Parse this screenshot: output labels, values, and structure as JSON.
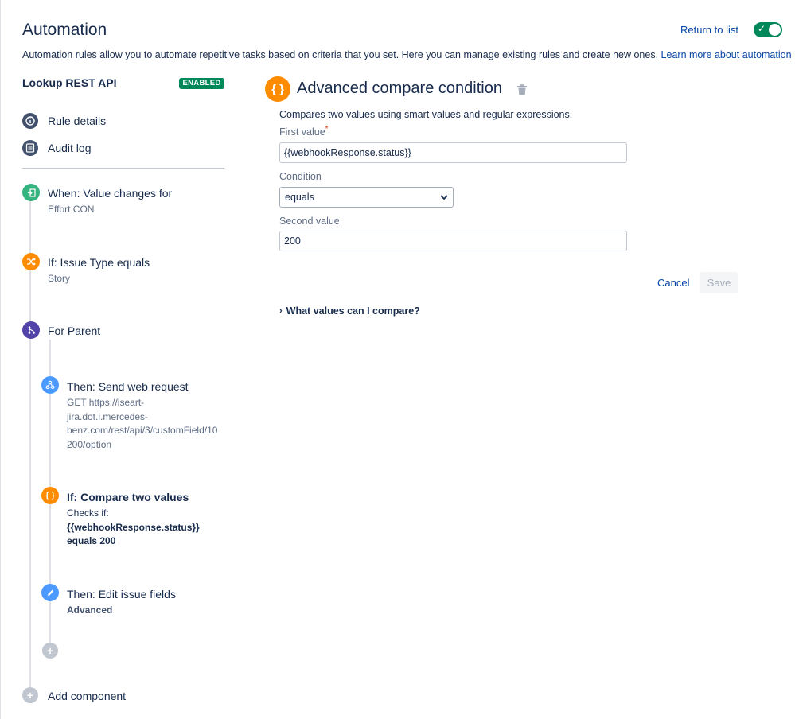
{
  "header": {
    "title": "Automation",
    "return_link": "Return to list",
    "toggle_state": "on",
    "description": "Automation rules allow you to automate repetitive tasks based on criteria that you set. Here you can manage existing rules and create new ones.",
    "learn_more": "Learn more about automation"
  },
  "sidebar": {
    "rule_name": "Lookup REST API",
    "status_badge": "ENABLED",
    "nav": [
      {
        "label": "Rule details",
        "icon": "info-icon"
      },
      {
        "label": "Audit log",
        "icon": "list-icon"
      }
    ],
    "steps": [
      {
        "title": "When: Value changes for",
        "sub": "Effort CON",
        "icon": "trigger-icon"
      },
      {
        "title": "If: Issue Type equals",
        "sub": "Story",
        "icon": "shuffle-icon"
      },
      {
        "title": "For Parent",
        "sub": "",
        "icon": "branch-icon"
      },
      {
        "title": "Then: Send web request",
        "sub_lines": [
          "GET https://iseart-",
          "jira.dot.i.mercedes-",
          "benz.com/rest/api/3/customField/10",
          "200/option"
        ],
        "icon": "webhook-icon"
      },
      {
        "title": "If: Compare two values",
        "sub_lines": [
          "Checks if:",
          "{{webhookResponse.status}}",
          "equals 200"
        ],
        "icon": "braces-icon"
      },
      {
        "title": "Then: Edit issue fields",
        "sub": "Advanced",
        "icon": "pencil-icon"
      }
    ],
    "add_component": "Add component"
  },
  "panel": {
    "icon_text": "{ }",
    "title": "Advanced compare condition",
    "description": "Compares two values using smart values and regular expressions.",
    "first_value_label": "First value",
    "required_mark": "*",
    "first_value": "{{webhookResponse.status}}",
    "condition_label": "Condition",
    "condition_value": "equals",
    "second_value_label": "Second value",
    "second_value": "200",
    "cancel": "Cancel",
    "save": "Save",
    "expander": "What values can I compare?"
  },
  "colors": {
    "accent_green": "#00875a",
    "link_blue": "#0747a6",
    "orange": "#ff8b00",
    "purple": "#5243aa"
  }
}
